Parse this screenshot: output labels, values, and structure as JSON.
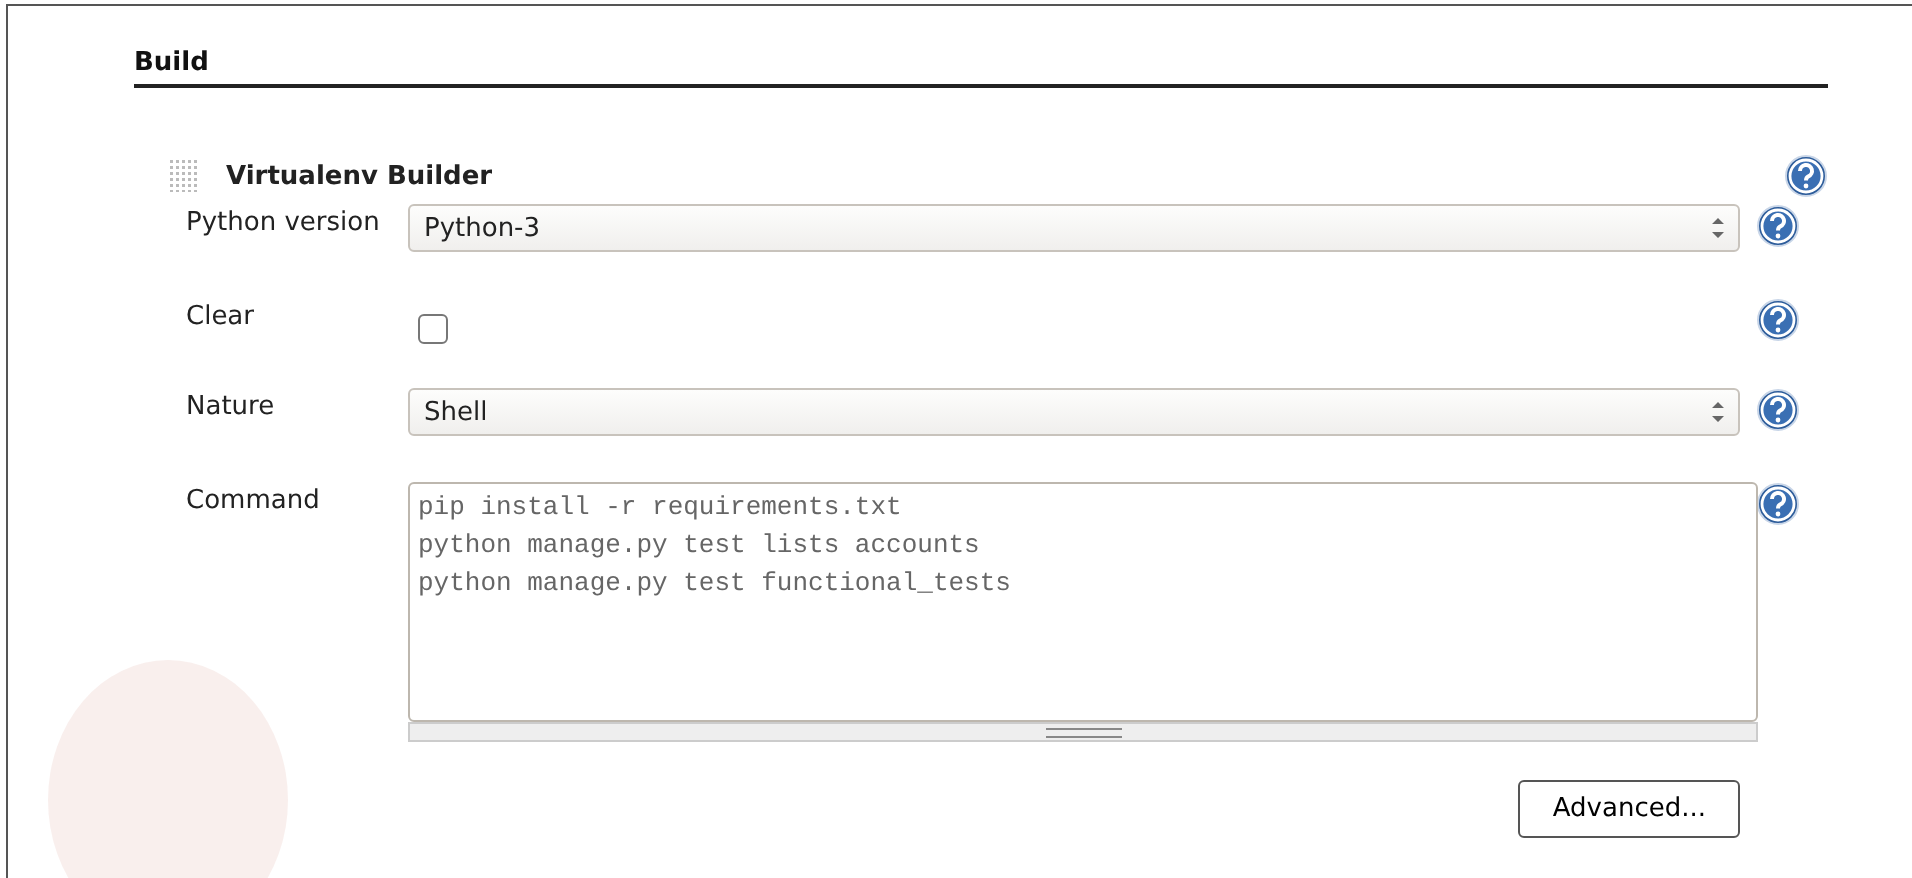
{
  "section": {
    "title": "Build"
  },
  "builder": {
    "title": "Virtualenv Builder",
    "fields": [
      {
        "kind": "select",
        "label": "Python version",
        "value": "Python-3"
      },
      {
        "kind": "checkbox",
        "label": "Clear",
        "checked": false
      },
      {
        "kind": "select",
        "label": "Nature",
        "value": "Shell"
      },
      {
        "kind": "textarea",
        "label": "Command",
        "value": "pip install -r requirements.txt\npython manage.py test lists accounts\npython manage.py test functional_tests"
      }
    ],
    "buttons": [
      "Advanced..."
    ]
  }
}
